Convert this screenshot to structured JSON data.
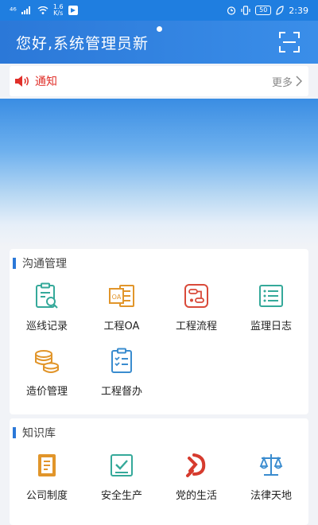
{
  "status_bar": {
    "signal": "⁴⁶",
    "speed_top": "1.6",
    "speed_bottom": "K/s",
    "battery": "50",
    "time": "2:39"
  },
  "header": {
    "greeting": "您好,系统管理员新"
  },
  "notice": {
    "label": "通知",
    "more": "更多"
  },
  "sections": {
    "communication": {
      "title": "沟通管理",
      "items": [
        {
          "label": "巡线记录",
          "icon": "patrol-record-icon"
        },
        {
          "label": "工程OA",
          "icon": "oa-icon"
        },
        {
          "label": "工程流程",
          "icon": "process-icon"
        },
        {
          "label": "监理日志",
          "icon": "log-icon"
        },
        {
          "label": "造价管理",
          "icon": "cost-icon"
        },
        {
          "label": "工程督办",
          "icon": "supervise-icon"
        }
      ]
    },
    "knowledge": {
      "title": "知识库",
      "items": [
        {
          "label": "公司制度",
          "icon": "company-policy-icon"
        },
        {
          "label": "安全生产",
          "icon": "safety-icon"
        },
        {
          "label": "党的生活",
          "icon": "party-icon"
        },
        {
          "label": "法律天地",
          "icon": "law-scale-icon"
        }
      ]
    }
  },
  "colors": {
    "header": "#2b78d8",
    "notice_red": "#e0302a",
    "teal": "#35a99a",
    "orange": "#e1952a"
  }
}
